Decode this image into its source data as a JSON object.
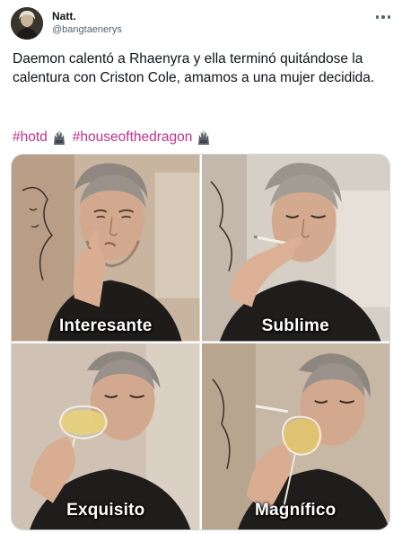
{
  "tweet": {
    "author_name": "Natt.",
    "author_handle": "@bangtaenerys",
    "text": "Daemon calentó a Rhaenyra y ella terminó quitándose la calentura con Criston Cole, amamos a una mujer decidida.",
    "hashtags": [
      "#hotd",
      "#houseofthedragon"
    ],
    "hashtag_color": "#c2338a",
    "more_icon": "more-horizontal-icon",
    "emoji_icon": "iron-throne-icon"
  },
  "media": {
    "panels": [
      {
        "caption": "Interesante"
      },
      {
        "caption": "Sublime"
      },
      {
        "caption": "Exquisito"
      },
      {
        "caption": "Magnífico"
      }
    ]
  }
}
